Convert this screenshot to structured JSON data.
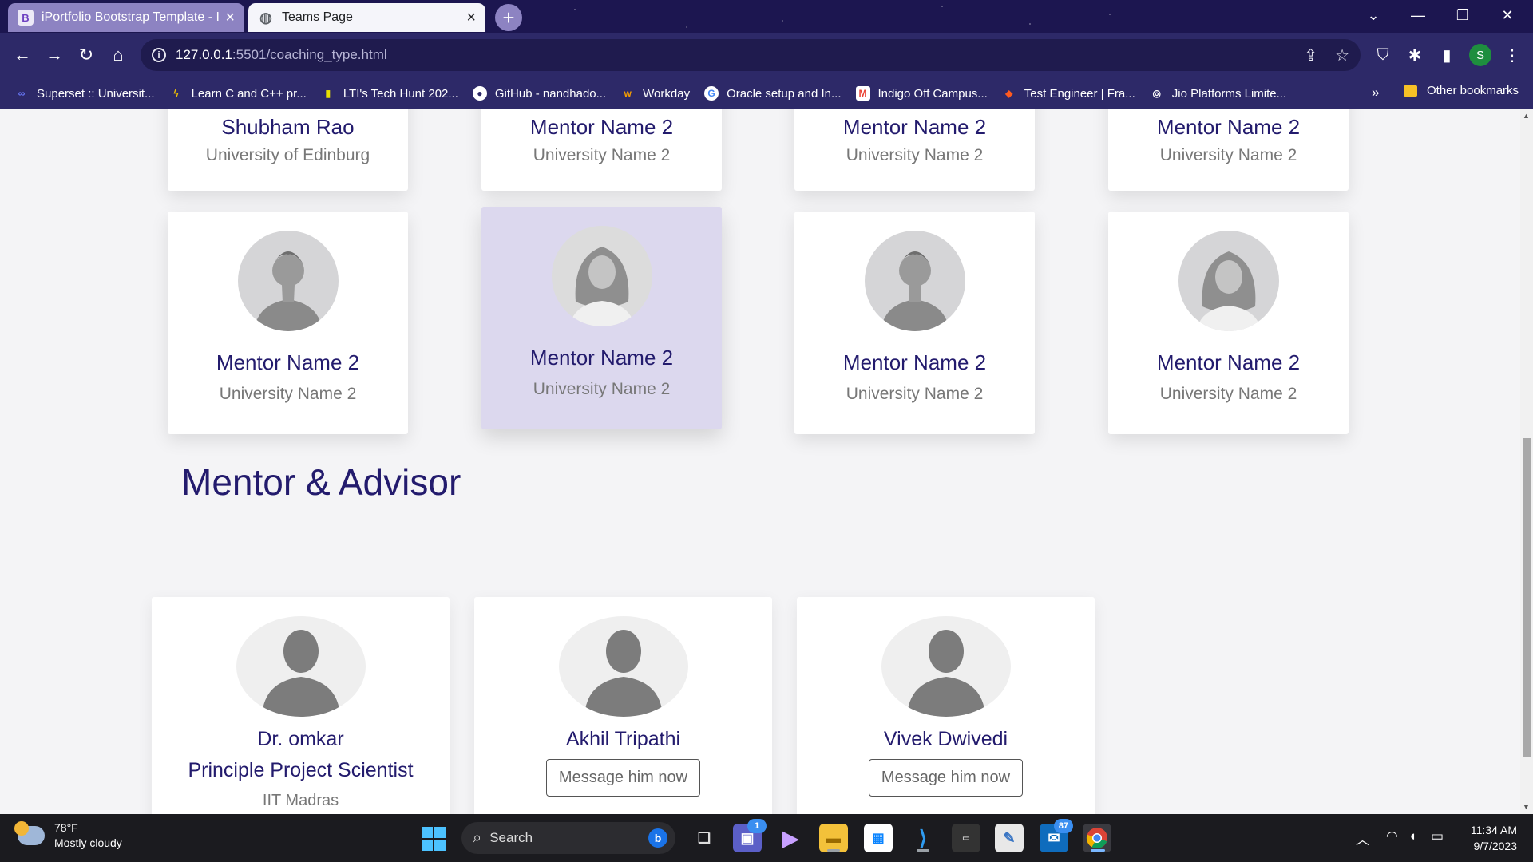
{
  "browser": {
    "tabs": [
      {
        "label": "iPortfolio Bootstrap Template - In",
        "icon": "bootstrap-icon"
      },
      {
        "label": "Teams Page",
        "icon": "globe-icon"
      }
    ],
    "url_host": "127.0.0.1",
    "url_path": ":5501/coaching_type.html",
    "profile_initial": "S",
    "bookmarks": [
      {
        "label": "Superset :: Universit...",
        "icon": "superset-icon",
        "color": "#6b7cff"
      },
      {
        "label": "Learn C and C++ pr...",
        "icon": "learn-c-icon",
        "color": "#f2c300"
      },
      {
        "label": "LTI's Tech Hunt 202...",
        "icon": "lti-icon",
        "color": "#e9e000"
      },
      {
        "label": "GitHub - nandhado...",
        "icon": "github-icon",
        "color": "#ffffff"
      },
      {
        "label": "Workday",
        "icon": "workday-icon",
        "color": "#f59d00"
      },
      {
        "label": "Oracle setup and In...",
        "icon": "google-icon",
        "color": "#ffffff"
      },
      {
        "label": "Indigo Off Campus...",
        "icon": "gmail-icon",
        "color": "#ea4335"
      },
      {
        "label": "Test Engineer | Fra...",
        "icon": "test-engineer-icon",
        "color": "#ff5a1f"
      },
      {
        "label": "Jio Platforms Limite...",
        "icon": "jio-icon",
        "color": "#ffffff"
      }
    ],
    "bookmarks_more": "»",
    "other_bookmarks": "Other bookmarks"
  },
  "mentors_top": [
    {
      "name": "Shubham Rao",
      "university": "University of Edinburg"
    },
    {
      "name": "Mentor Name 2",
      "university": "University Name 2"
    },
    {
      "name": "Mentor Name 2",
      "university": "University Name 2"
    },
    {
      "name": "Mentor Name 2",
      "university": "University Name 2"
    }
  ],
  "mentors_row2": [
    {
      "name": "Mentor Name 2",
      "university": "University Name 2",
      "avatar": "male-avatar-icon"
    },
    {
      "name": "Mentor Name 2",
      "university": "University Name 2",
      "avatar": "female-avatar-icon"
    },
    {
      "name": "Mentor Name 2",
      "university": "University Name 2",
      "avatar": "male-avatar-icon"
    },
    {
      "name": "Mentor Name 2",
      "university": "University Name 2",
      "avatar": "female-avatar-icon"
    }
  ],
  "advisor_section": {
    "title": "Mentor & Advisor",
    "people": [
      {
        "name": "Dr. omkar",
        "title": "Principle Project Scientist",
        "university": "IIT Madras"
      },
      {
        "name": "Akhil Tripathi",
        "button": "Message him now"
      },
      {
        "name": "Vivek Dwivedi",
        "button": "Message him now"
      }
    ]
  },
  "taskbar": {
    "weather_temp": "78°F",
    "weather_desc": "Mostly cloudy",
    "search_label": "Search",
    "teams_badge": "1",
    "outlook_badge": "87",
    "time": "11:34 AM",
    "date": "9/7/2023"
  },
  "colors": {
    "accent": "#231b6d",
    "tabstrip": "#1c1650",
    "toolbar": "#2d2968",
    "hover_card": "#dcd8ee"
  }
}
